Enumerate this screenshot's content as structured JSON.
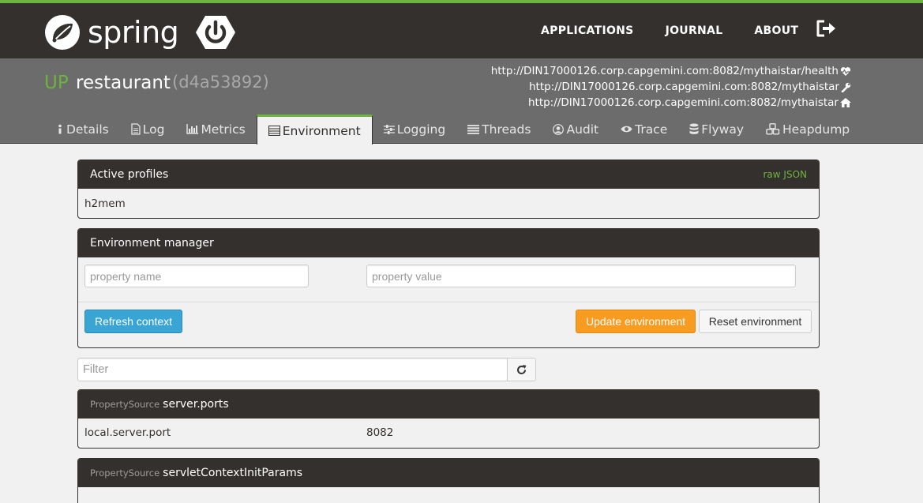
{
  "brand": {
    "name": "spring"
  },
  "nav": {
    "applications": "APPLICATIONS",
    "journal": "JOURNAL",
    "about": "ABOUT"
  },
  "app": {
    "status": "UP",
    "name": "restaurant",
    "id": "(d4a53892)",
    "health_url": "http://DIN17000126.corp.capgemini.com:8082/mythaistar/health",
    "management_url": "http://DIN17000126.corp.capgemini.com:8082/mythaistar",
    "service_url": "http://DIN17000126.corp.capgemini.com:8082/mythaistar"
  },
  "tabs": [
    {
      "label": "Details",
      "icon": "info-icon"
    },
    {
      "label": "Log",
      "icon": "file-icon"
    },
    {
      "label": "Metrics",
      "icon": "bar-chart-icon"
    },
    {
      "label": "Environment",
      "icon": "list-icon"
    },
    {
      "label": "Logging",
      "icon": "sliders-icon"
    },
    {
      "label": "Threads",
      "icon": "threads-icon"
    },
    {
      "label": "Audit",
      "icon": "user-icon"
    },
    {
      "label": "Trace",
      "icon": "eye-icon"
    },
    {
      "label": "Flyway",
      "icon": "database-icon"
    },
    {
      "label": "Heapdump",
      "icon": "cubes-icon"
    }
  ],
  "active_tab": "Environment",
  "profiles": {
    "title": "Active profiles",
    "raw_link": "raw JSON",
    "value": "h2mem"
  },
  "env_manager": {
    "title": "Environment manager",
    "name_placeholder": "property name",
    "value_placeholder": "property value",
    "refresh": "Refresh context",
    "update": "Update environment",
    "reset": "Reset environment"
  },
  "filter": {
    "placeholder": "Filter"
  },
  "property_sources": [
    {
      "prefix": "PropertySource",
      "name": "server.ports",
      "key": "local.server.port",
      "value": "8082"
    },
    {
      "prefix": "PropertySource",
      "name": "servletContextInitParams"
    }
  ],
  "colors": {
    "dark": "#34302d",
    "green": "#6db33f",
    "gray": "#6c6c6c",
    "blue": "#39a5d4",
    "orange": "#f89b21"
  }
}
